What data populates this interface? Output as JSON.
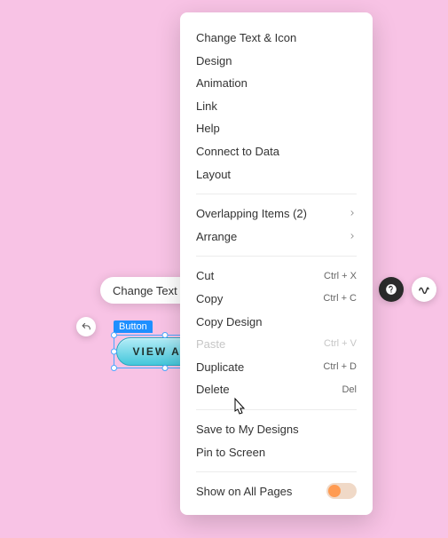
{
  "selection": {
    "label": "Button",
    "button_text": "VIEW ALL"
  },
  "toolbar": {
    "change_text_label": "Change Text"
  },
  "menu": {
    "change_text_icon": "Change Text & Icon",
    "design": "Design",
    "animation": "Animation",
    "link": "Link",
    "help": "Help",
    "connect_to_data": "Connect to Data",
    "layout": "Layout",
    "overlapping_items": "Overlapping Items (2)",
    "arrange": "Arrange",
    "cut": "Cut",
    "cut_sc": "Ctrl + X",
    "copy": "Copy",
    "copy_sc": "Ctrl + C",
    "copy_design": "Copy Design",
    "paste": "Paste",
    "paste_sc": "Ctrl + V",
    "duplicate": "Duplicate",
    "duplicate_sc": "Ctrl + D",
    "delete": "Delete",
    "delete_sc": "Del",
    "save_to_my_designs": "Save to My Designs",
    "pin_to_screen": "Pin to Screen",
    "show_on_all_pages": "Show on All Pages"
  }
}
